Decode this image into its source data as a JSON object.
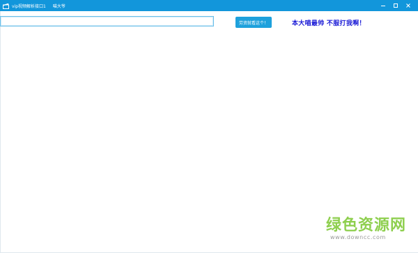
{
  "window": {
    "title": "vip视频解析接口1",
    "title_extra": "喵大爷",
    "accent_color": "#1296db",
    "icons": {
      "app": "clapperboard-icon",
      "minimize": "minimize-icon",
      "maximize": "maximize-icon",
      "close": "close-icon"
    }
  },
  "main": {
    "url_input": {
      "value": "",
      "placeholder": ""
    },
    "parse_button_label": "劳资就看这个！",
    "slogan": "本大喵最帅 不服打我啊！",
    "slogan_color": "#1a1ad6"
  },
  "watermark": {
    "brand": "绿色资源网",
    "url": "www.downcc.com",
    "brand_color": "#8ecf4e"
  }
}
